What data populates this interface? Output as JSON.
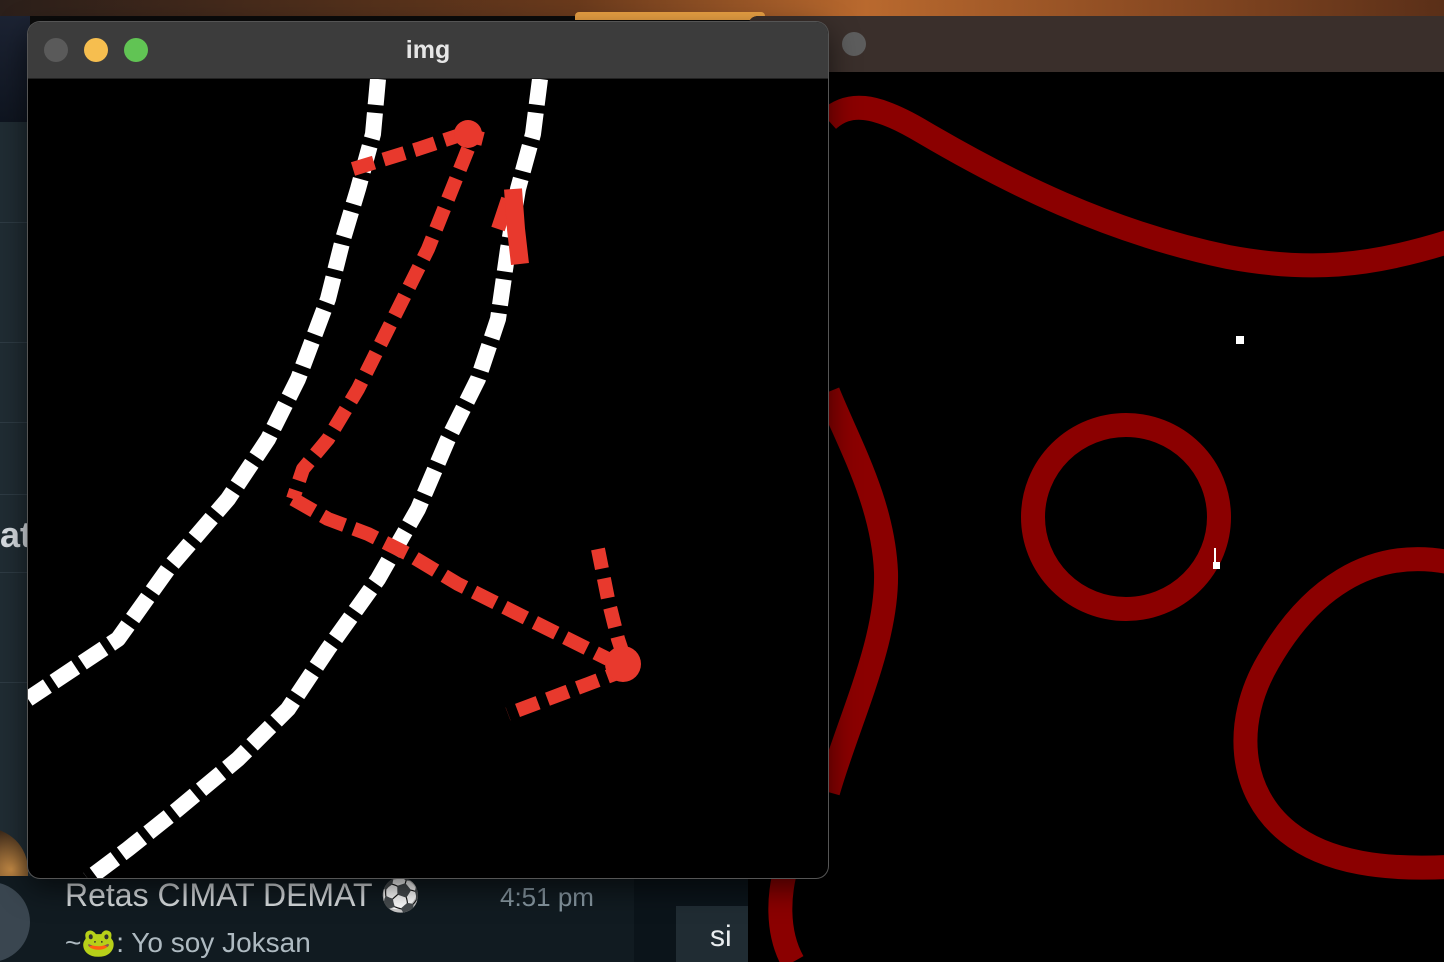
{
  "img_window": {
    "title": "img",
    "buttons": [
      "close",
      "minimize",
      "maximize"
    ]
  },
  "chat_app": {
    "partial_text": "at",
    "chat": {
      "name": "Retas CIMAT DEMAT ⚽",
      "time": "4:51 pm",
      "preview": "~🐸: Yo soy Joksan",
      "bubble_text": "si"
    }
  },
  "colors": {
    "contour_red": "#8b0000",
    "edge_white": "#ffffff",
    "path_red": "#e8392d",
    "close_button": "#5a5a5a",
    "minimize_button": "#f6be4f",
    "maximize_button": "#61c454"
  }
}
